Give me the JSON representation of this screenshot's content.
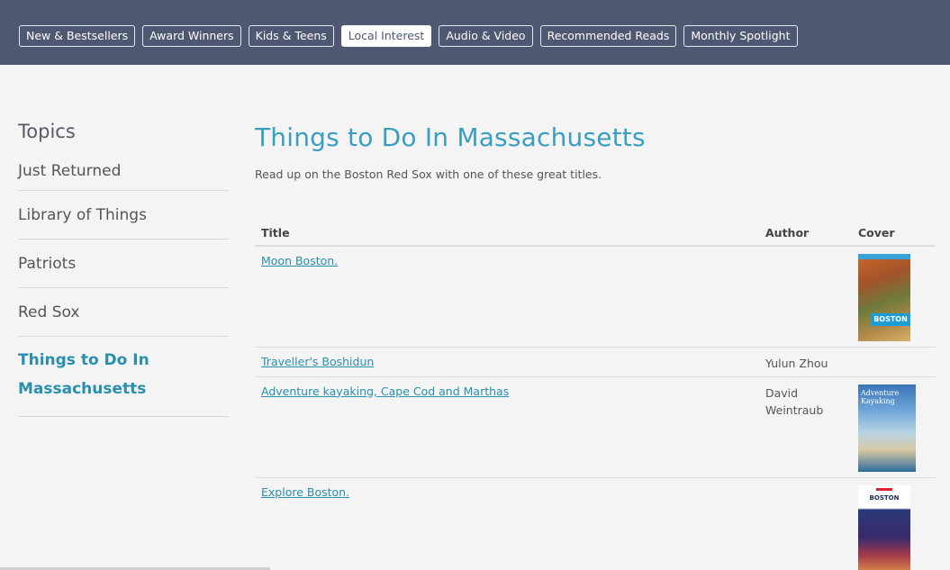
{
  "topnav": {
    "tabs": [
      "New & Bestsellers",
      "Award Winners",
      "Kids & Teens",
      "Local Interest",
      "Audio & Video",
      "Recommended Reads",
      "Monthly Spotlight"
    ],
    "active_tab": "Local Interest"
  },
  "sidebar": {
    "heading": "Topics",
    "items": [
      "Just Returned",
      "Library of Things",
      "Patriots",
      "Red Sox",
      "Things to Do In Massachusetts"
    ],
    "active_item": "Things to Do In Massachusetts"
  },
  "main": {
    "title": "Things to Do In Massachusetts",
    "intro": "Read up on the Boston Red Sox with one of these great titles."
  },
  "table": {
    "headers": [
      "Title",
      "Author",
      "Cover"
    ],
    "rows": [
      {
        "title": "Moon Boston.",
        "author": "",
        "cover_label": "BOSTON"
      },
      {
        "title": "Traveller's Boshidun",
        "author": "Yulun Zhou",
        "cover_label": ""
      },
      {
        "title": "Adventure kayaking, Cape Cod and Marthas",
        "author": "David Weintraub",
        "cover_label": "Adventure Kayaking"
      },
      {
        "title": "Explore Boston.",
        "author": "",
        "cover_label": "BOSTON"
      }
    ]
  },
  "colors": {
    "nav_bg": "#4f5872",
    "accent": "#2a8fae",
    "page_bg": "#f4f4f4"
  }
}
